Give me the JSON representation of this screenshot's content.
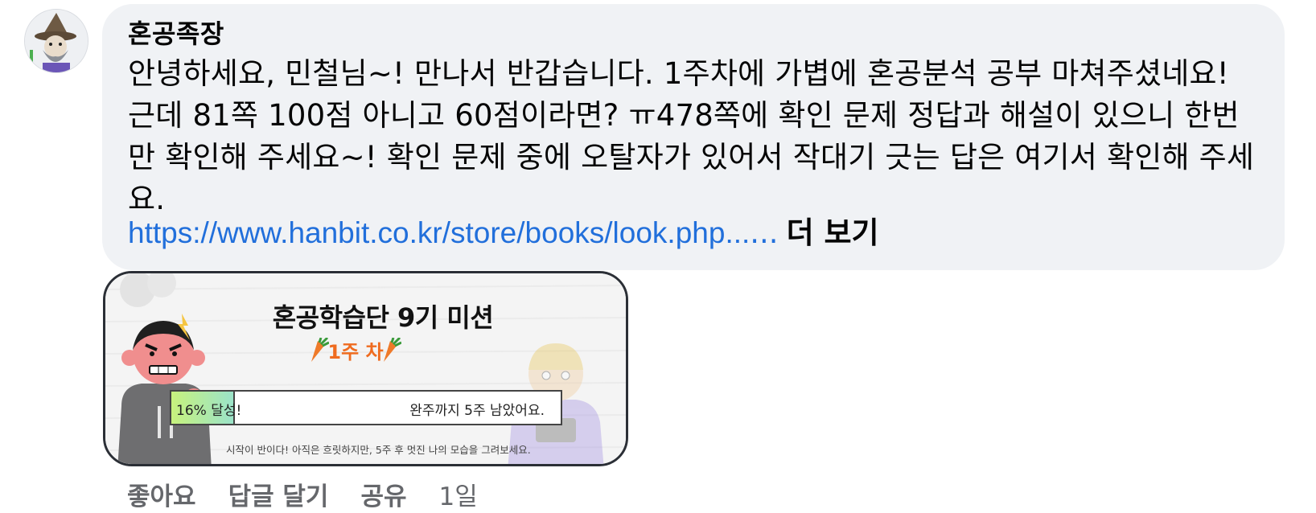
{
  "comment": {
    "author": "혼공족장",
    "text": "안녕하세요, 민철님~! 만나서 반갑습니다. 1주차에 가볍에 혼공분석 공부 마쳐주셨네요! 근데 81쪽 100점 아니고 60점이라면? ㅠ478쪽에 확인 문제 정답과 해설이 있으니 한번만 확인해 주세요~! 확인 문제 중에 오탈자가 있어서 작대기 긋는 답은 여기서 확인해 주세요.",
    "link_text": "https://www.hanbit.co.kr/store/books/look.php...",
    "ellipsis": "...",
    "see_more": "더 보기",
    "avatar_icon": "wizard-avatar-icon"
  },
  "attachment": {
    "title": "혼공학습단 9기 미션",
    "week_label": "1주 차",
    "progress_label": "16% 달성!",
    "progress_fraction": 0.16,
    "remaining_text": "완주까지 5주 남았어요.",
    "tagline": "시작이 반이다! 아직은 흐릿하지만, 5주 후 멋진 나의 모습을 그려보세요.",
    "accent_color": "#ef6b1f"
  },
  "actions": {
    "like": "좋아요",
    "reply": "답글 달기",
    "share": "공유",
    "time": "1일"
  }
}
